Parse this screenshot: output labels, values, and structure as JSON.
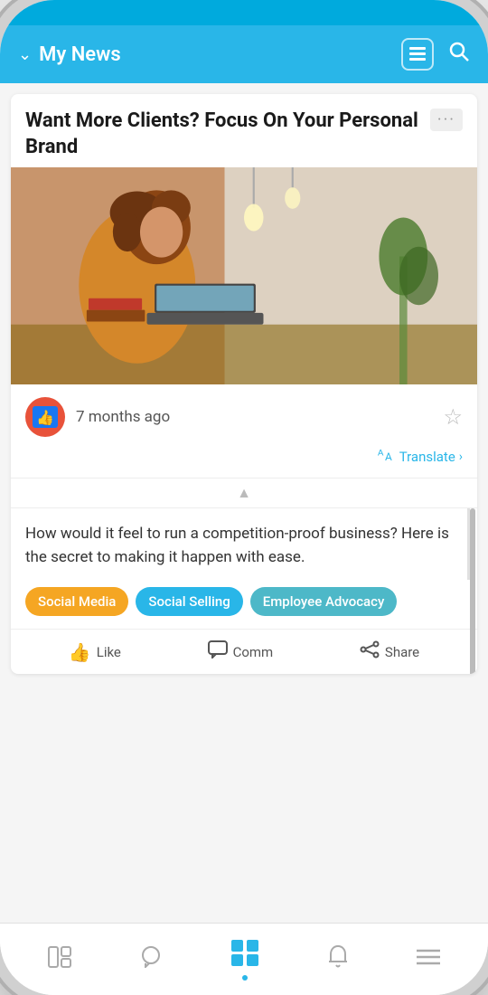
{
  "header": {
    "title": "My News",
    "chevron": "⌄",
    "icon_list": "☰",
    "icon_search": "🔍"
  },
  "card": {
    "title": "Want More Clients? Focus On Your Personal Brand",
    "menu_label": "···",
    "time_ago": "7 months ago",
    "translate_label": "Translate",
    "excerpt": "How would it feel to run a competition-proof business? Here is the secret to making it happen with ease.",
    "tags": [
      {
        "label": "Social Media",
        "color": "orange"
      },
      {
        "label": "Social Selling",
        "color": "blue"
      },
      {
        "label": "Employee Advocacy",
        "color": "teal"
      }
    ],
    "actions": [
      {
        "label": "Like",
        "icon": "👍"
      },
      {
        "label": "Comm",
        "icon": "💬"
      },
      {
        "label": "Share",
        "icon": "🔗"
      }
    ]
  },
  "bottom_nav": [
    {
      "icon": "☰",
      "label": "feed",
      "active": false
    },
    {
      "icon": "💬",
      "label": "chat",
      "active": false
    },
    {
      "icon": "⊞",
      "label": "home",
      "active": true
    },
    {
      "icon": "🔔",
      "label": "notifications",
      "active": false
    },
    {
      "icon": "≡",
      "label": "menu",
      "active": false
    }
  ]
}
